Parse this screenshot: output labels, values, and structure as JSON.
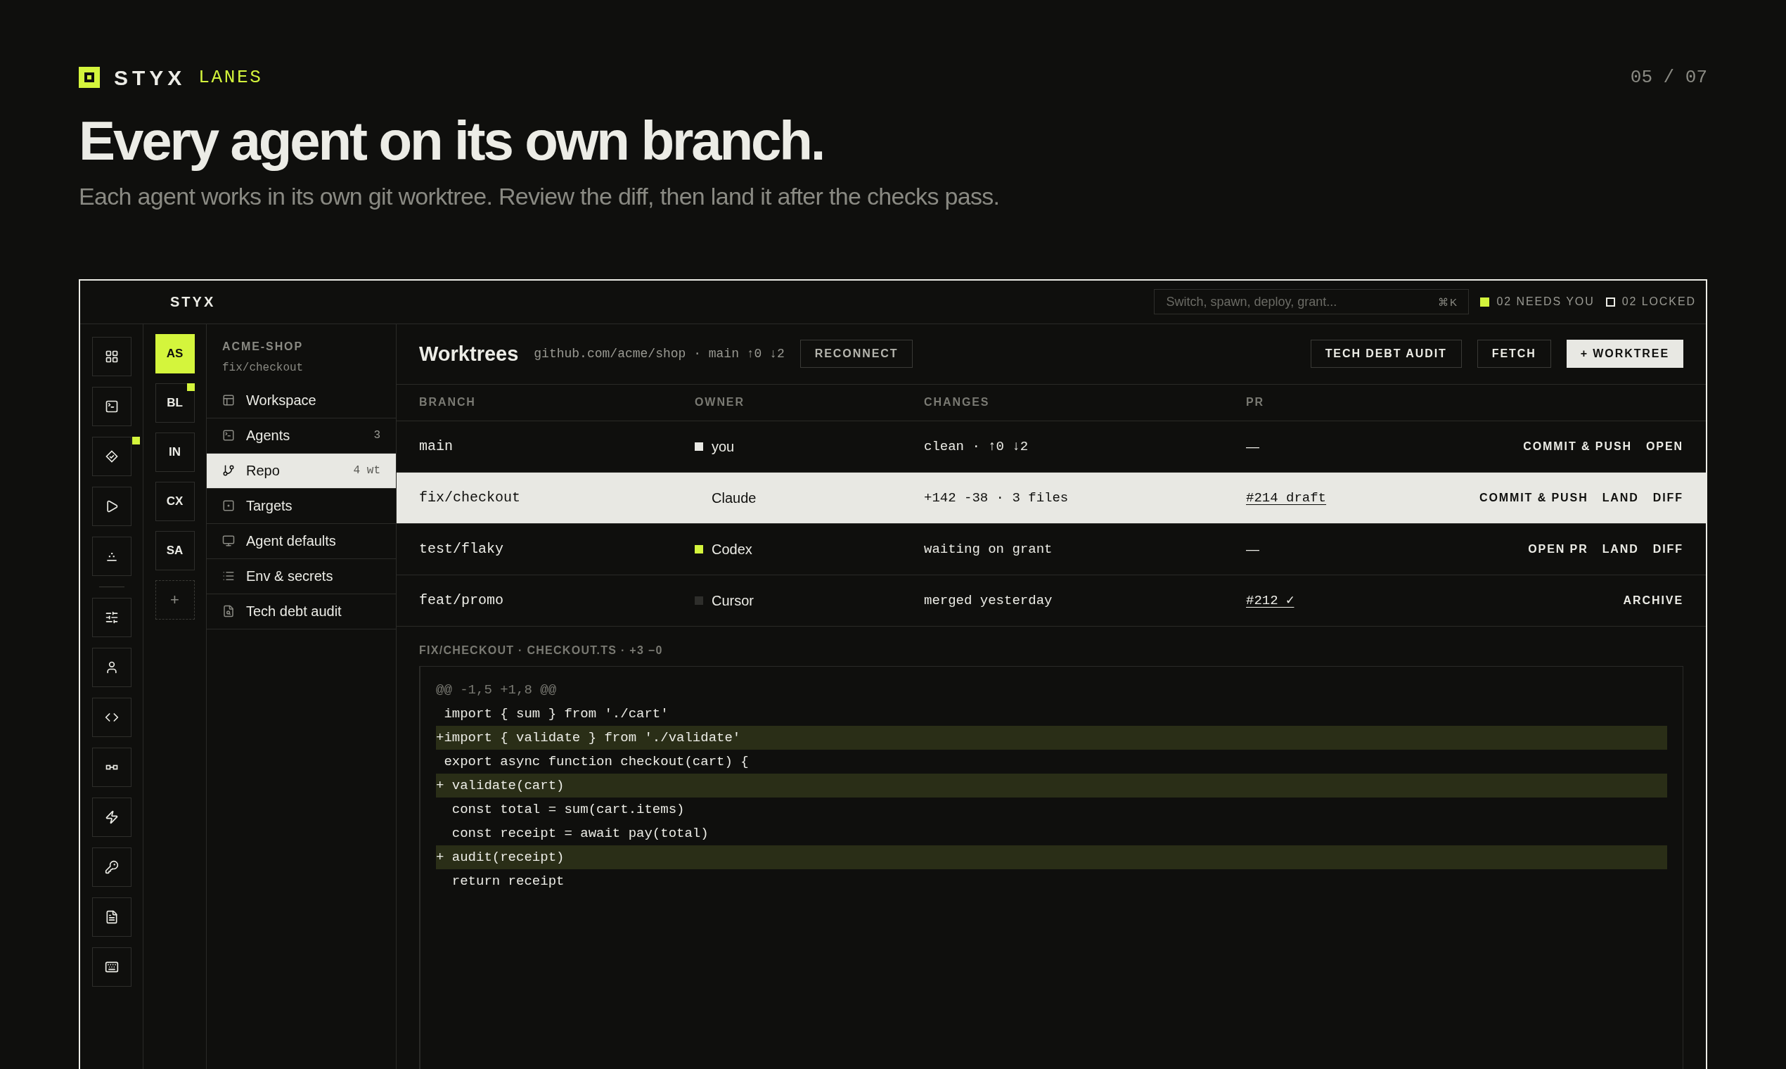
{
  "brand": {
    "name": "STYX",
    "section": "LANES",
    "page": "05 / 07"
  },
  "headline": "Every agent on its own branch.",
  "subtitle": "Each agent works in its own git worktree. Review the diff, then land it after the checks pass.",
  "app": {
    "name": "STYX",
    "search": {
      "placeholder": "Switch, spawn, deploy, grant...",
      "shortcut": "⌘K"
    },
    "status": [
      {
        "kind": "filled",
        "text": "02 NEEDS YOU"
      },
      {
        "kind": "hollow",
        "text": "02 LOCKED"
      }
    ],
    "rail": [
      {
        "kind": "tool",
        "alert": false
      },
      {
        "kind": "tool",
        "alert": false
      },
      {
        "kind": "tool",
        "alert": true
      },
      {
        "kind": "tool",
        "alert": false
      },
      {
        "kind": "tool",
        "alert": false
      },
      {
        "kind": "divider",
        "alert": false
      },
      {
        "kind": "tool",
        "alert": false
      },
      {
        "kind": "tool",
        "alert": false
      },
      {
        "kind": "tool",
        "alert": false
      },
      {
        "kind": "tool",
        "alert": false
      },
      {
        "kind": "tool",
        "alert": false
      },
      {
        "kind": "tool",
        "alert": false
      },
      {
        "kind": "tool",
        "alert": false
      },
      {
        "kind": "tool",
        "alert": false
      }
    ],
    "agents": [
      {
        "label": "AS",
        "selected": true,
        "alert": false
      },
      {
        "label": "BL",
        "selected": false,
        "alert": true
      },
      {
        "label": "IN",
        "selected": false,
        "alert": false
      },
      {
        "label": "CX",
        "selected": false,
        "alert": false
      },
      {
        "label": "SA",
        "selected": false,
        "alert": false
      },
      {
        "label": "+",
        "selected": false,
        "alert": false,
        "kind": "add"
      }
    ],
    "project": {
      "name": "ACME-SHOP",
      "branch": "fix/checkout"
    },
    "nav": [
      {
        "label": "Workspace",
        "selected": false
      },
      {
        "label": "Agents",
        "count": "3",
        "selected": false
      },
      {
        "label": "Repo",
        "count": "4 wt",
        "selected": true
      },
      {
        "label": "Targets",
        "selected": false
      },
      {
        "label": "Agent defaults",
        "selected": false
      },
      {
        "label": "Env & secrets",
        "selected": false
      },
      {
        "label": "Tech debt audit",
        "selected": false
      }
    ],
    "worktrees": {
      "title": "Worktrees",
      "meta": "github.com/acme/shop · main ↑0 ↓2",
      "reconnect": "RECONNECT",
      "actions": [
        {
          "label": "TECH DEBT AUDIT",
          "primary": false
        },
        {
          "label": "FETCH",
          "primary": false
        },
        {
          "label": "+ WORKTREE",
          "primary": true
        }
      ],
      "columns": [
        "BRANCH",
        "OWNER",
        "CHANGES",
        "PR"
      ],
      "rows": [
        {
          "branch": "main",
          "owner": "you",
          "color": "#e8e8e3",
          "changes": "clean · ↑0 ↓2",
          "pr": {
            "text": "—",
            "linked": false
          },
          "actions": [
            "COMMIT & PUSH",
            "OPEN"
          ],
          "selected": false
        },
        {
          "branch": "fix/checkout",
          "owner": "Claude",
          "changes": "+142 -38 · 3 files",
          "pr": {
            "text": "#214 draft",
            "linked": true
          },
          "actions": [
            "COMMIT & PUSH",
            "LAND",
            "DIFF"
          ],
          "selected": true
        },
        {
          "branch": "test/flaky",
          "owner": "Codex",
          "color": "#d4f53c",
          "changes": "waiting on grant",
          "pr": {
            "text": "—",
            "linked": false
          },
          "actions": [
            "OPEN PR",
            "LAND",
            "DIFF"
          ],
          "selected": false
        },
        {
          "branch": "feat/promo",
          "owner": "Cursor",
          "color": "#2e2e2b",
          "changes": "merged yesterday",
          "pr": {
            "text": "#212 ✓",
            "linked": true
          },
          "actions": [
            "ARCHIVE"
          ],
          "selected": false
        }
      ]
    },
    "diff": {
      "title": "FIX/CHECKOUT · CHECKOUT.TS · +3 −0",
      "lines": [
        {
          "kind": "hunk",
          "text": "@@ -1,5 +1,8 @@"
        },
        {
          "kind": "context",
          "text": " import { sum } from './cart'"
        },
        {
          "kind": "added",
          "text": "+import { validate } from './validate'"
        },
        {
          "kind": "context",
          "text": " export async function checkout(cart) {"
        },
        {
          "kind": "added",
          "text": "+ validate(cart)"
        },
        {
          "kind": "context",
          "text": "  const total = sum(cart.items)"
        },
        {
          "kind": "context",
          "text": "  const receipt = await pay(total)"
        },
        {
          "kind": "added",
          "text": "+ audit(receipt)"
        },
        {
          "kind": "context",
          "text": "  return receipt"
        }
      ]
    }
  }
}
